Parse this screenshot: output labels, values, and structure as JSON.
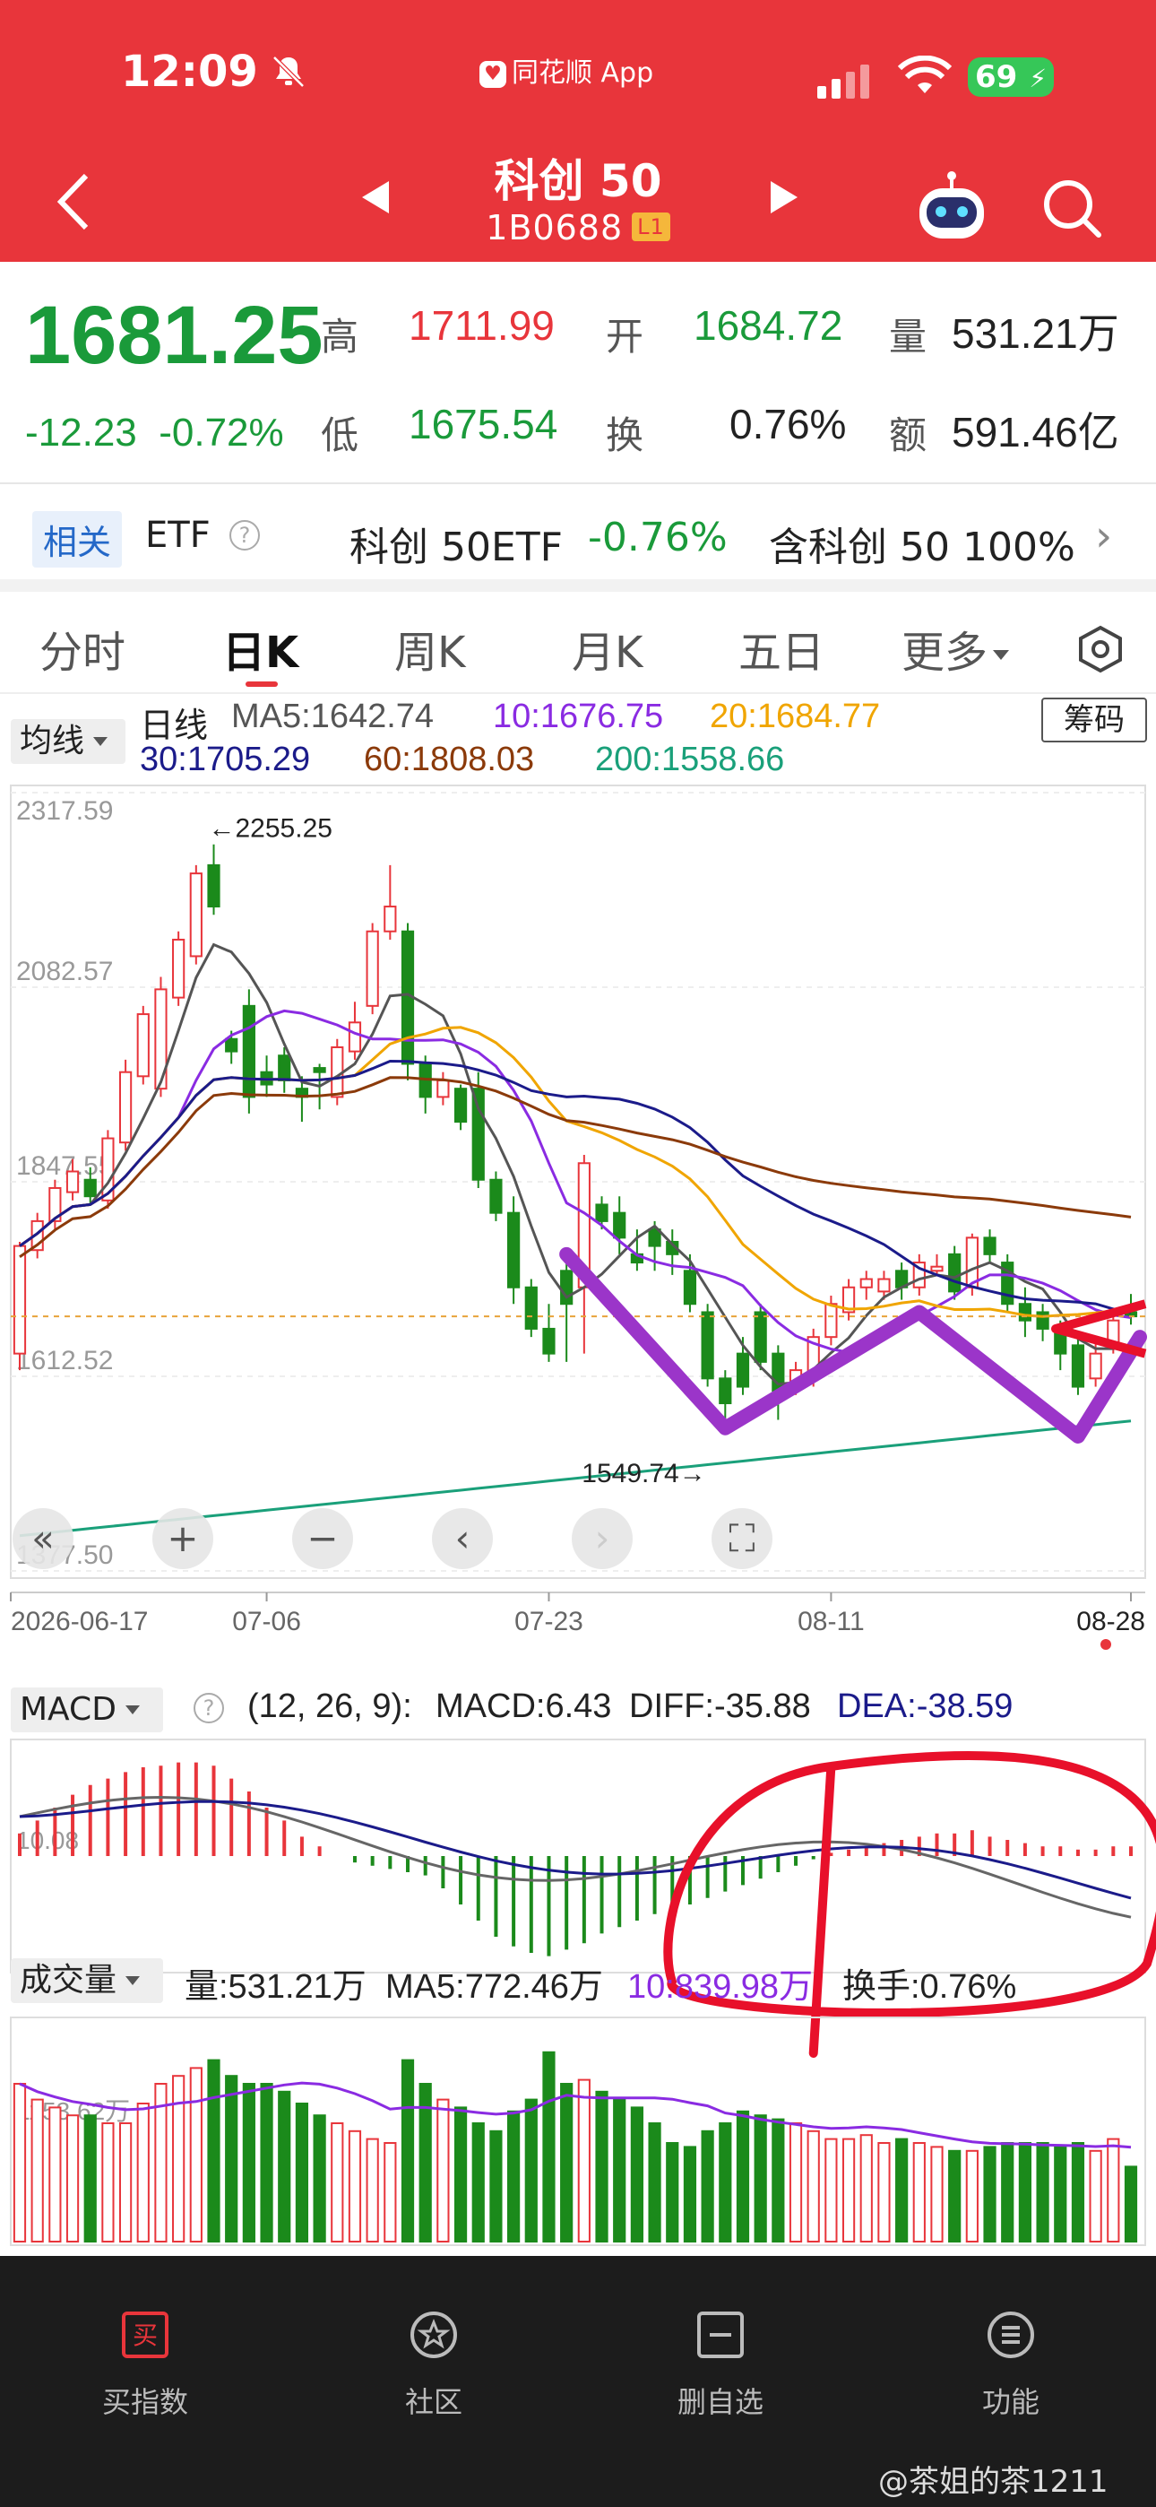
{
  "status": {
    "time": "12:09",
    "app": "同花顺 App",
    "battery": "69"
  },
  "nav": {
    "title": "科创 50",
    "code": "1B0688",
    "level": "L1"
  },
  "quote": {
    "price": "1681.25",
    "change": "-12.23",
    "change_pct": "-0.72%",
    "high_label": "高",
    "high": "1711.99",
    "open_label": "开",
    "open": "1684.72",
    "vol_label": "量",
    "vol": "531.21万",
    "low_label": "低",
    "low": "1675.54",
    "turnover_label": "换",
    "turnover": "0.76%",
    "amount_label": "额",
    "amount": "591.46亿"
  },
  "related": {
    "tag": "相关",
    "etf": "ETF",
    "name": "科创 50ETF",
    "pct": "-0.76%",
    "inc": "含科创 50 100%"
  },
  "tabs": [
    "分时",
    "日K",
    "周K",
    "月K",
    "五日",
    "更多"
  ],
  "ma": {
    "select": "均线",
    "type": "日线",
    "ma5": "MA5:1642.74",
    "ma10": "10:1676.75",
    "ma20": "20:1684.77",
    "ma30": "30:1705.29",
    "ma60": "60:1808.03",
    "ma200": "200:1558.66",
    "chouma": "筹码"
  },
  "colors": {
    "up": "#e8353b",
    "down": "#1b8a1b",
    "ma5": "#555555",
    "ma10": "#8a2be2",
    "ma20": "#f0a500",
    "ma30": "#1b1b8a",
    "ma60": "#8b3a0a",
    "ma200": "#1aa07a"
  },
  "macd": {
    "select": "MACD",
    "params": "(12, 26, 9):",
    "macd": "MACD:6.43",
    "diff": "DIFF:-35.88",
    "dea": "DEA:-38.59",
    "axis": "10.08"
  },
  "vol": {
    "select": "成交量",
    "v": "量:531.21万",
    "ma5": "MA5:772.46万",
    "ma10": "10:839.98万",
    "turn": "换手:0.76%",
    "axis": "1153.62万"
  },
  "chart_data": {
    "type": "candlestick",
    "y_ticks": [
      "2317.59",
      "2082.57",
      "1847.55",
      "1612.52",
      "1377.50"
    ],
    "ylim": [
      1377.5,
      2317.59
    ],
    "x_labels": [
      "2026-06-17",
      "07-06",
      "07-23",
      "08-11",
      "08-28"
    ],
    "annotations": {
      "high": "←2255.25",
      "low": "1549.74→"
    },
    "candles": [
      [
        1640,
        1770,
        1620,
        1775
      ],
      [
        1765,
        1800,
        1755,
        1810
      ],
      [
        1800,
        1840,
        1790,
        1850
      ],
      [
        1835,
        1860,
        1825,
        1875
      ],
      [
        1850,
        1830,
        1820,
        1865
      ],
      [
        1825,
        1900,
        1815,
        1910
      ],
      [
        1895,
        1980,
        1885,
        1995
      ],
      [
        1975,
        2050,
        1965,
        2060
      ],
      [
        1960,
        2080,
        1950,
        2095
      ],
      [
        2070,
        2140,
        2060,
        2150
      ],
      [
        2120,
        2220,
        2110,
        2230
      ],
      [
        2230,
        2180,
        2170,
        2255
      ],
      [
        2020,
        2005,
        1990,
        2030
      ],
      [
        2060,
        1950,
        1930,
        2080
      ],
      [
        1980,
        1965,
        1950,
        2000
      ],
      [
        2000,
        1970,
        1955,
        2010
      ],
      [
        1960,
        1950,
        1920,
        1975
      ],
      [
        1985,
        1980,
        1935,
        1990
      ],
      [
        1950,
        2010,
        1940,
        2020
      ],
      [
        2005,
        2040,
        1995,
        2065
      ],
      [
        2060,
        2150,
        2050,
        2160
      ],
      [
        2150,
        2180,
        2140,
        2230
      ],
      [
        2150,
        1990,
        1970,
        2160
      ],
      [
        1990,
        1950,
        1930,
        2000
      ],
      [
        1950,
        1970,
        1940,
        1980
      ],
      [
        1960,
        1920,
        1910,
        1965
      ],
      [
        1960,
        1850,
        1840,
        1980
      ],
      [
        1850,
        1810,
        1800,
        1860
      ],
      [
        1810,
        1720,
        1700,
        1830
      ],
      [
        1720,
        1670,
        1660,
        1730
      ],
      [
        1670,
        1640,
        1630,
        1700
      ],
      [
        1740,
        1700,
        1630,
        1750
      ],
      [
        1720,
        1870,
        1640,
        1880
      ],
      [
        1820,
        1800,
        1790,
        1830
      ],
      [
        1810,
        1780,
        1760,
        1830
      ],
      [
        1760,
        1750,
        1740,
        1790
      ],
      [
        1790,
        1770,
        1740,
        1800
      ],
      [
        1775,
        1760,
        1735,
        1790
      ],
      [
        1740,
        1700,
        1690,
        1760
      ],
      [
        1690,
        1610,
        1600,
        1700
      ],
      [
        1610,
        1580,
        1550,
        1620
      ],
      [
        1640,
        1600,
        1590,
        1660
      ],
      [
        1690,
        1630,
        1620,
        1700
      ],
      [
        1640,
        1595,
        1560,
        1650
      ],
      [
        1600,
        1620,
        1590,
        1630
      ],
      [
        1610,
        1660,
        1600,
        1670
      ],
      [
        1660,
        1700,
        1650,
        1710
      ],
      [
        1690,
        1720,
        1680,
        1730
      ],
      [
        1720,
        1730,
        1705,
        1740
      ],
      [
        1715,
        1730,
        1705,
        1740
      ],
      [
        1740,
        1720,
        1705,
        1750
      ],
      [
        1720,
        1750,
        1710,
        1760
      ],
      [
        1740,
        1745,
        1735,
        1760
      ],
      [
        1760,
        1715,
        1705,
        1770
      ],
      [
        1720,
        1780,
        1710,
        1785
      ],
      [
        1780,
        1760,
        1750,
        1790
      ],
      [
        1750,
        1700,
        1690,
        1760
      ],
      [
        1700,
        1680,
        1660,
        1720
      ],
      [
        1690,
        1670,
        1655,
        1700
      ],
      [
        1670,
        1640,
        1620,
        1680
      ],
      [
        1650,
        1600,
        1590,
        1660
      ],
      [
        1610,
        1640,
        1600,
        1660
      ],
      [
        1650,
        1680,
        1640,
        1690
      ],
      [
        1690,
        1685,
        1675,
        1712
      ]
    ],
    "macd_bars": [
      14,
      22,
      30,
      38,
      44,
      48,
      52,
      55,
      56,
      58,
      58,
      56,
      48,
      40,
      30,
      22,
      12,
      6,
      0,
      -4,
      -6,
      -8,
      -10,
      -12,
      -20,
      -30,
      -40,
      -50,
      -56,
      -60,
      -62,
      -58,
      -54,
      -48,
      -44,
      -40,
      -36,
      -34,
      -30,
      -26,
      -22,
      -18,
      -14,
      -10,
      -6,
      -2,
      2,
      4,
      6,
      8,
      10,
      12,
      14,
      14,
      16,
      12,
      10,
      8,
      6,
      6,
      4,
      4,
      6,
      6
    ],
    "volume": [
      1300,
      1260,
      1240,
      1220,
      1220,
      1200,
      1200,
      1250,
      1300,
      1320,
      1340,
      1360,
      1320,
      1300,
      1300,
      1280,
      1250,
      1220,
      1200,
      1180,
      1160,
      1150,
      1360,
      1300,
      1260,
      1240,
      1200,
      1180,
      1230,
      1260,
      1380,
      1300,
      1310,
      1280,
      1260,
      1240,
      1200,
      1150,
      1140,
      1180,
      1200,
      1230,
      1220,
      1210,
      1200,
      1180,
      1160,
      1160,
      1170,
      1150,
      1160,
      1150,
      1140,
      1130,
      1130,
      1140,
      1150,
      1150,
      1150,
      1140,
      1150,
      1130,
      1160,
      1090
    ]
  },
  "bottom": [
    {
      "label": "买指数",
      "icon": "buy"
    },
    {
      "label": "社区",
      "icon": "community"
    },
    {
      "label": "删自选",
      "icon": "remove"
    },
    {
      "label": "功能",
      "icon": "menu"
    }
  ],
  "watermark": "@茶姐的茶1211"
}
